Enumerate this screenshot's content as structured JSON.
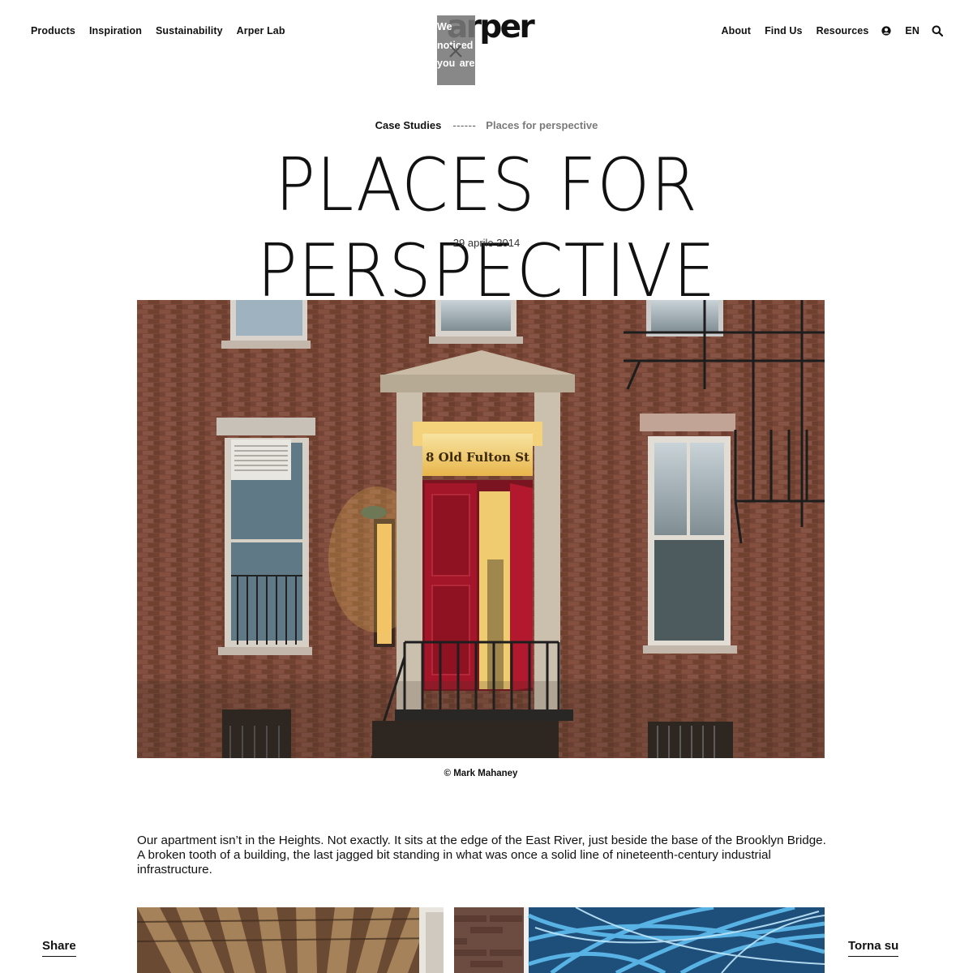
{
  "header": {
    "nav_left": [
      "Products",
      "Inspiration",
      "Sustainability",
      "Arper Lab"
    ],
    "logo_text": "arper",
    "nav_right": [
      "About",
      "Find Us",
      "Resources"
    ],
    "user_icon": "user-circle-icon",
    "language": "EN",
    "search_icon": "search-icon"
  },
  "notice": {
    "text": "We noticed you are",
    "close_icon": "close-icon"
  },
  "breadcrumb": {
    "home": "Case Studies",
    "separator": "------",
    "current": "Places for perspective"
  },
  "article": {
    "title": "PLACES FOR PERSPECTIVE",
    "date": "29 aprile 2014",
    "hero_sign": "8 Old Fulton St",
    "photo_credit": "© Mark Mahaney",
    "paragraph": "Our apartment isn’t in the Heights. Not exactly. It sits at the edge of the East River, just beside the base of the Brooklyn Bridge. A broken tooth of a building, the last jagged bit standing in what was once a solid line of nineteenth-century industrial infrastructure."
  },
  "footer_links": {
    "share": "Share",
    "back_to_top": "Torna su"
  },
  "colors": {
    "text": "#111111",
    "breadcrumb_current": "#7a7a7a",
    "brick": "#7e4a3a",
    "door_red": "#a3162a",
    "glass_blue": "#4aa3d8"
  }
}
